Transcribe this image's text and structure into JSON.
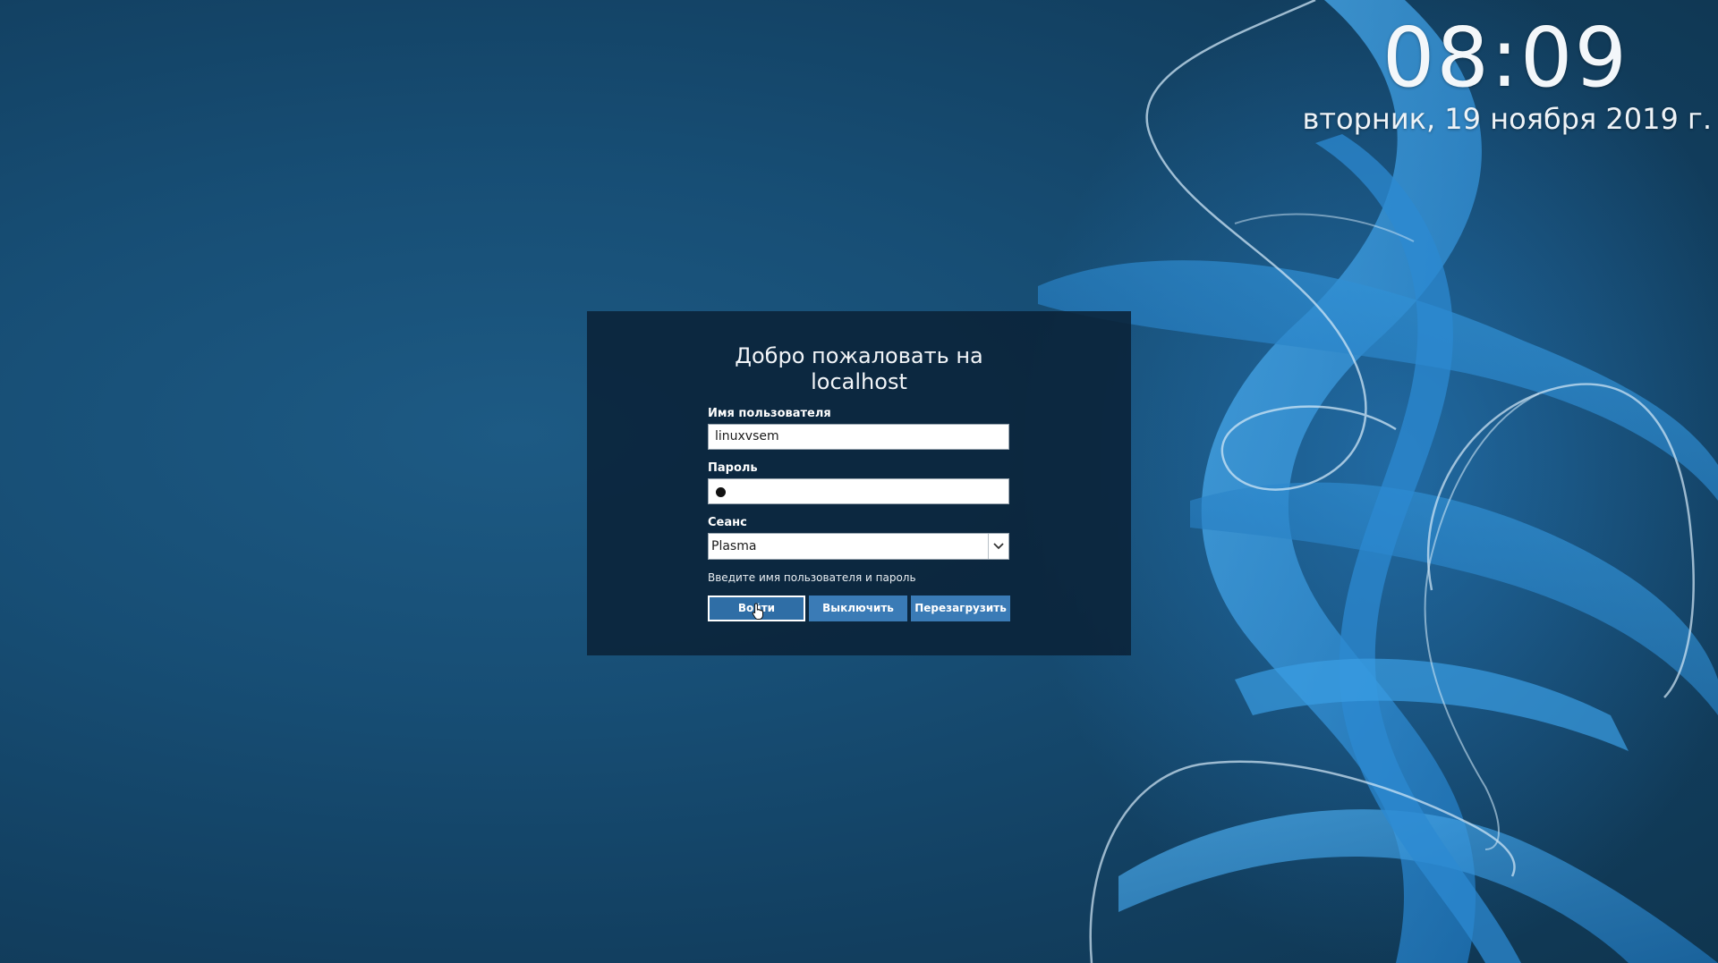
{
  "clock": {
    "time": "08:09",
    "date": "вторник, 19 ноября 2019 г."
  },
  "login": {
    "welcome_line1": "Добро пожаловать на",
    "welcome_line2": "localhost",
    "username_label": "Имя пользователя",
    "username_value": "linuxvsem",
    "password_label": "Пароль",
    "session_label": "Сеанс",
    "session_value": "Plasma",
    "hint": "Введите имя пользователя и пароль",
    "login_button": "Войти",
    "shutdown_button": "Выключить",
    "reboot_button": "Перезагрузить"
  },
  "icons": {
    "dropdown": "chevron-down-icon",
    "cursor": "hand-pointer-icon"
  },
  "colors": {
    "background": "#174e75",
    "panel": "#0a2238",
    "button": "#3a7bb6",
    "swirl": "#2f8fd8"
  }
}
